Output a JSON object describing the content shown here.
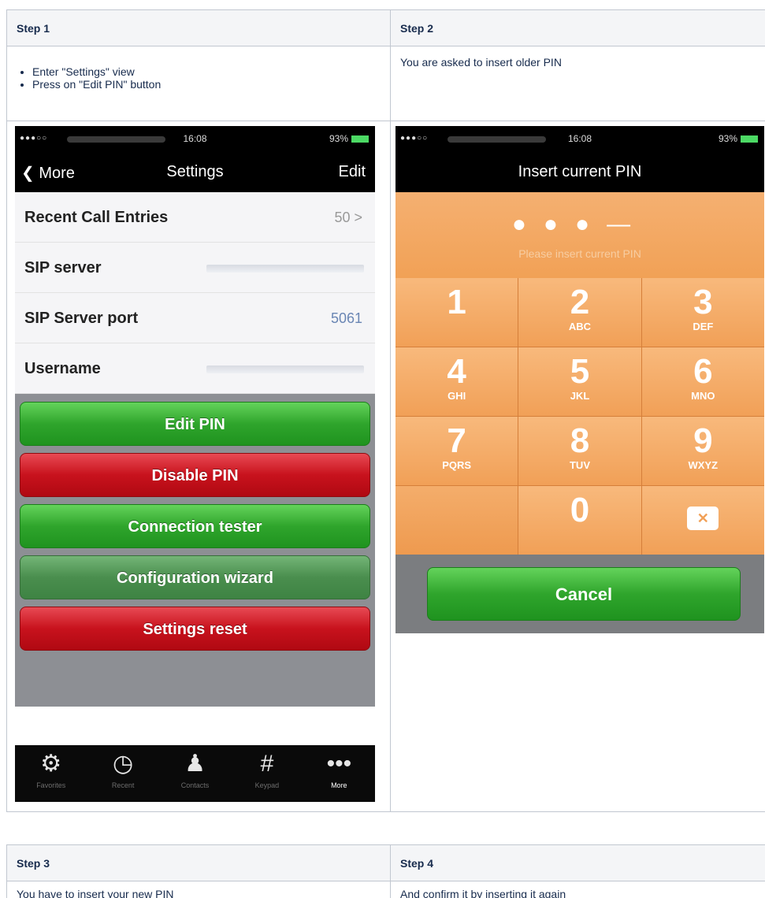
{
  "table1": {
    "headers": [
      "Step 1",
      "Step 2"
    ],
    "step1_bullets": [
      "Enter \"Settings\" view",
      "Press on \"Edit PIN\" button"
    ],
    "step2_text": "You are asked to insert older PIN"
  },
  "phone_settings": {
    "status": {
      "time": "16:08",
      "battery": "93%"
    },
    "nav": {
      "back": "More",
      "title": "Settings",
      "edit": "Edit"
    },
    "rows": [
      {
        "label": "Recent Call Entries",
        "value": "50 >"
      },
      {
        "label": "SIP server",
        "value": ""
      },
      {
        "label": "SIP Server port",
        "value": "5061"
      },
      {
        "label": "Username",
        "value": ""
      }
    ],
    "buttons": {
      "edit_pin": "Edit PIN",
      "disable_pin": "Disable PIN",
      "connection_tester": "Connection tester",
      "configuration_wizard": "Configuration wizard",
      "settings_reset": "Settings reset"
    },
    "tabs": [
      {
        "label": "Favorites",
        "icon": "gear-icon"
      },
      {
        "label": "Recent",
        "icon": "clock-icon"
      },
      {
        "label": "Contacts",
        "icon": "person-icon"
      },
      {
        "label": "Keypad",
        "icon": "hash-icon"
      },
      {
        "label": "More",
        "icon": "more-icon"
      }
    ]
  },
  "phone_pin": {
    "status": {
      "time": "16:08",
      "battery": "93%"
    },
    "title": "Insert current PIN",
    "hint": "Please insert current PIN",
    "keys": [
      {
        "num": "1",
        "letters": ""
      },
      {
        "num": "2",
        "letters": "ABC"
      },
      {
        "num": "3",
        "letters": "DEF"
      },
      {
        "num": "4",
        "letters": "GHI"
      },
      {
        "num": "5",
        "letters": "JKL"
      },
      {
        "num": "6",
        "letters": "MNO"
      },
      {
        "num": "7",
        "letters": "PQRS"
      },
      {
        "num": "8",
        "letters": "TUV"
      },
      {
        "num": "9",
        "letters": "WXYZ"
      },
      {
        "num": "0",
        "letters": ""
      }
    ],
    "cancel": "Cancel"
  },
  "table2": {
    "headers": [
      "Step 3",
      "Step 4"
    ],
    "step3_text": "You have to insert your new PIN",
    "step4_text": "And confirm it by inserting it again"
  },
  "colors": {
    "accent_green": "#2fa52c",
    "accent_red": "#c8121d",
    "pin_orange": "#f1a057"
  }
}
